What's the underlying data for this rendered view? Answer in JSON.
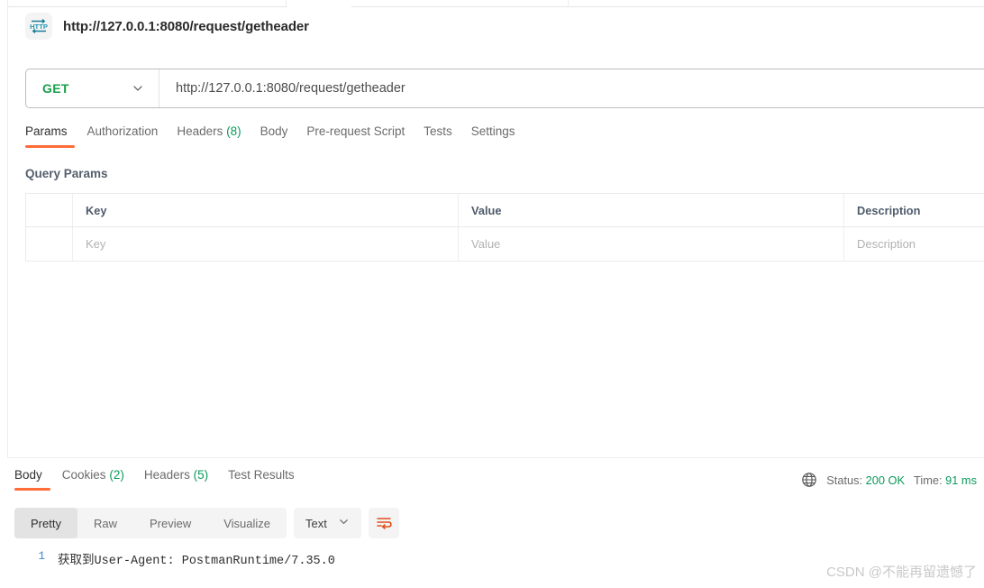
{
  "request": {
    "icon": "http-protocol-icon",
    "title": "http://127.0.0.1:8080/request/getheader",
    "method": "GET",
    "url": "http://127.0.0.1:8080/request/getheader",
    "tabs": [
      {
        "label": "Params",
        "count": ""
      },
      {
        "label": "Authorization",
        "count": ""
      },
      {
        "label": "Headers",
        "count": "(8)"
      },
      {
        "label": "Body",
        "count": ""
      },
      {
        "label": "Pre-request Script",
        "count": ""
      },
      {
        "label": "Tests",
        "count": ""
      },
      {
        "label": "Settings",
        "count": ""
      }
    ],
    "active_tab": "Params",
    "section_label": "Query Params",
    "params_table": {
      "headers": [
        "Key",
        "Value",
        "Description"
      ],
      "rows": [
        {
          "key": "Key",
          "value": "Value",
          "description": "Description"
        }
      ]
    }
  },
  "response": {
    "tabs": [
      {
        "label": "Body",
        "count": ""
      },
      {
        "label": "Cookies",
        "count": "(2)"
      },
      {
        "label": "Headers",
        "count": "(5)"
      },
      {
        "label": "Test Results",
        "count": ""
      }
    ],
    "active_tab": "Body",
    "status_prefix": "Status:",
    "status_value": "200 OK",
    "time_prefix": "Time:",
    "time_value": "91 ms",
    "globe_icon": "globe-icon",
    "view_modes": [
      "Pretty",
      "Raw",
      "Preview",
      "Visualize"
    ],
    "active_view": "Pretty",
    "format": "Text",
    "wrap_icon": "word-wrap-icon",
    "lines": [
      {
        "num": "1",
        "text": "获取到User-Agent: PostmanRuntime/7.35.0"
      }
    ]
  },
  "watermark": "CSDN @不能再留遗憾了",
  "colors": {
    "accent": "#ff6c37",
    "method_get": "#18a04a",
    "success": "#0b9a5a",
    "gutter": "#3a86c8",
    "http_icon": "#1b7f96"
  }
}
